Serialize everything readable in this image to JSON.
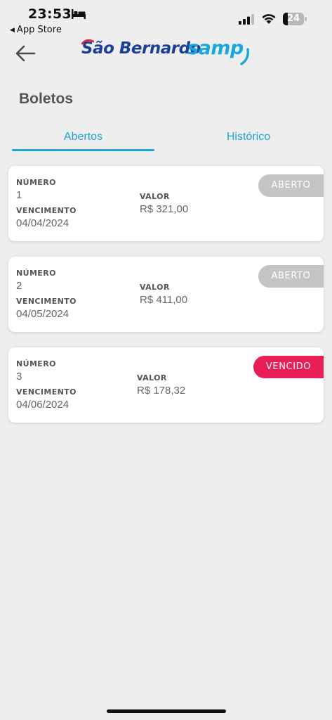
{
  "status_bar": {
    "time": "23:53",
    "back_app": "App Store",
    "battery_level": 24
  },
  "header": {
    "logo_main": "São Bernardo",
    "logo_accent_word": "samp",
    "brand_colors": {
      "dark_blue": "#1b3f9b",
      "light_blue": "#1aa7dc",
      "red": "#e0262f"
    }
  },
  "page": {
    "title": "Boletos"
  },
  "tabs": [
    {
      "label": "Abertos",
      "active": true
    },
    {
      "label": "Histórico",
      "active": false
    }
  ],
  "labels": {
    "numero": "NÚMERO",
    "vencimento": "VENCIMENTO",
    "valor": "VALOR"
  },
  "boletos": [
    {
      "numero": "1",
      "vencimento": "04/04/2024",
      "valor": "R$ 321,00",
      "status": "ABERTO",
      "status_color": "#c4c4c4"
    },
    {
      "numero": "2",
      "vencimento": "04/05/2024",
      "valor": "R$ 411,00",
      "status": "ABERTO",
      "status_color": "#c4c4c4"
    },
    {
      "numero": "3",
      "vencimento": "04/06/2024",
      "valor": "R$ 178,32",
      "status": "VENCIDO",
      "status_color": "#ea1e57"
    }
  ],
  "colors": {
    "accent": "#1aa3d4",
    "background": "#eeeeee",
    "card": "#ffffff"
  }
}
